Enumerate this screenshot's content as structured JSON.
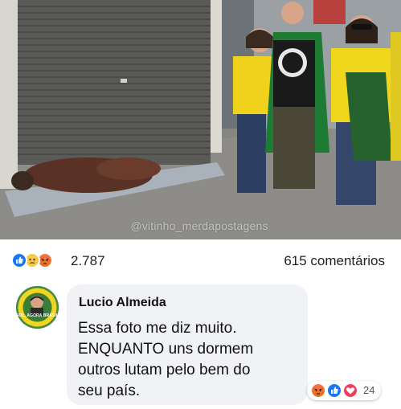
{
  "post": {
    "watermark": "@vitinho_merdapostagens",
    "reactions": {
      "icons": [
        "like-icon",
        "sad-icon",
        "angry-icon"
      ],
      "count": "2.787"
    },
    "comments_label": "615 comentários"
  },
  "comment": {
    "author": "Lucio Almeida",
    "avatar_text": "SOL, AGORA BRASIL",
    "text_lines": [
      "Essa foto me diz muito.",
      "ENQUANTO uns dormem",
      "outros lutam pelo bem do",
      "seu país."
    ],
    "reactions": {
      "icons": [
        "angry-icon",
        "like-icon",
        "love-icon"
      ],
      "count": "24"
    }
  },
  "colors": {
    "like": "#1877f2",
    "love": "#f33e58",
    "angry_top": "#f7714c",
    "angry_bottom": "#e9710f",
    "sad": "#f7c948",
    "bubble": "#f0f2f5"
  }
}
